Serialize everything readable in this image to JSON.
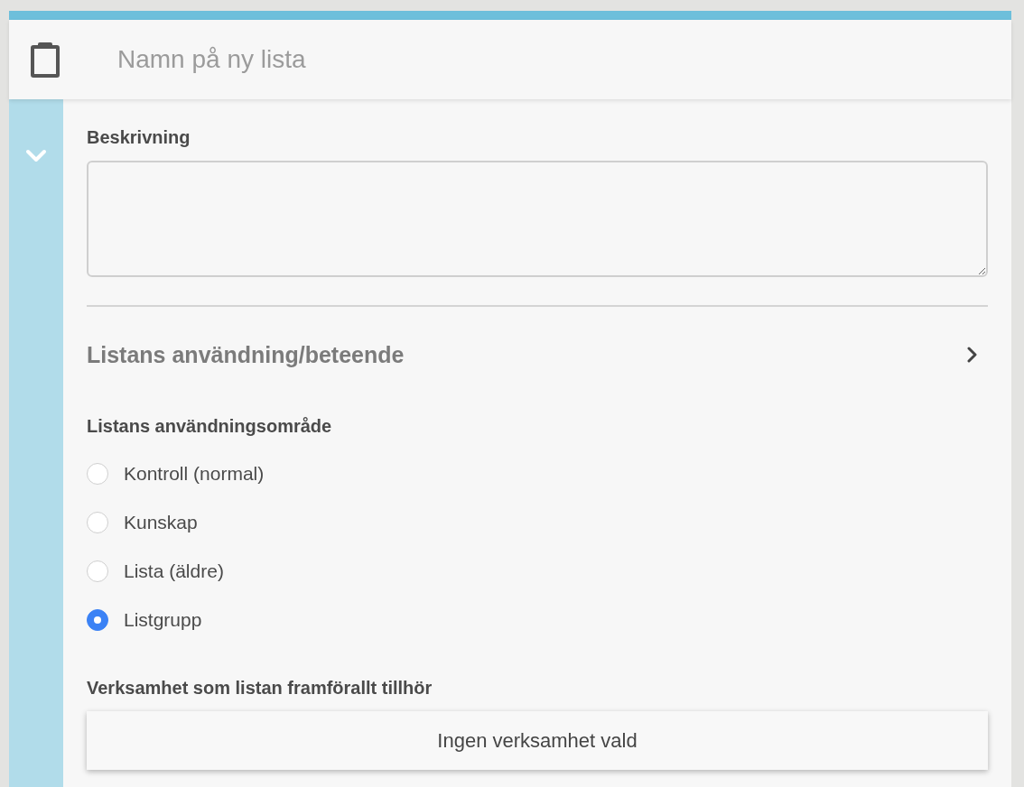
{
  "header": {
    "name_field": {
      "placeholder": "Namn på ny lista"
    }
  },
  "sidebar": {
    "expanded": true
  },
  "description": {
    "label": "Beskrivning"
  },
  "behavior_section": {
    "title": "Listans användning/beteende",
    "expanded": false
  },
  "usage_area": {
    "label": "Listans användningsområde",
    "options": [
      {
        "label": "Kontroll (normal)",
        "selected": false
      },
      {
        "label": "Kunskap",
        "selected": false
      },
      {
        "label": "Lista (äldre)",
        "selected": false
      },
      {
        "label": "Listgrupp",
        "selected": true
      }
    ]
  },
  "organization": {
    "label": "Verksamhet som listan framförallt tillhör",
    "button": "Ingen verksamhet vald"
  }
}
